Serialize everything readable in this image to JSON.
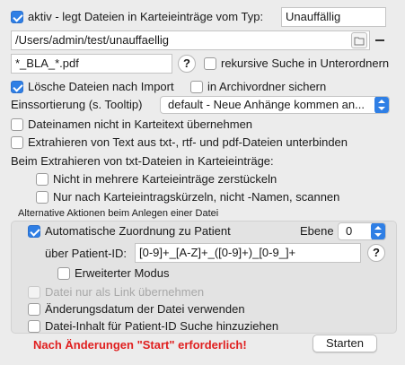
{
  "top": {
    "aktiv_label": "aktiv - legt Dateien in Karteieinträge vom Typ:",
    "aktiv_checked": true,
    "type_value": "Unauffällig",
    "path_value": "/Users/admin/test/unauffaellig",
    "pattern_value": "*_BLA_*.pdf",
    "recursive_label": "rekursive Suche in Unterordnern",
    "recursive_checked": false
  },
  "options": {
    "delete_label": "Lösche Dateien nach Import",
    "delete_checked": true,
    "archive_label": "in Archivordner sichern",
    "archive_checked": false,
    "sort_label": "Einssortierung (s. Tooltip)",
    "sort_value": "default - Neue Anhänge kommen an...",
    "filenames_label": "Dateinamen nicht in Karteitext übernehmen",
    "filenames_checked": false,
    "extract_label": "Extrahieren von Text aus txt-, rtf- und pdf-Dateien unterbinden",
    "extract_checked": false
  },
  "txt_section": {
    "heading": "Beim Extrahieren von txt-Dateien in Karteieinträge:",
    "no_split_label": "Nicht in mehrere Karteieinträge zerstückeln",
    "no_split_checked": false,
    "only_abbrev_label": "Nur nach Karteieintragskürzeln, nicht -Namen, scannen",
    "only_abbrev_checked": false
  },
  "alt_actions": {
    "heading": "Alternative Aktionen beim Anlegen einer Datei",
    "auto_assign_label": "Automatische Zuordnung zu Patient",
    "auto_assign_checked": true,
    "level_label": "Ebene",
    "level_value": "0",
    "patient_id_label": "über Patient-ID:",
    "patient_id_value": "[0-9]+_[A-Z]+_([0-9]+)_[0-9_]+",
    "extended_label": "Erweiterter Modus",
    "extended_checked": false
  },
  "bottom": {
    "link_only_label": "Datei nur als Link übernehmen",
    "link_only_checked": false,
    "change_date_label": "Änderungsdatum der Datei verwenden",
    "change_date_checked": false,
    "file_content_label": "Datei-Inhalt für Patient-ID Suche hinzuziehen",
    "file_content_checked": false,
    "warning": "Nach Änderungen \"Start\" erforderlich!",
    "warning_color": "#e02020",
    "start_label": "Starten"
  },
  "icons": {
    "help": "?",
    "folder_browse": "folder-icon",
    "remove": "minus"
  },
  "colors": {
    "accent": "#2f7fe5"
  }
}
